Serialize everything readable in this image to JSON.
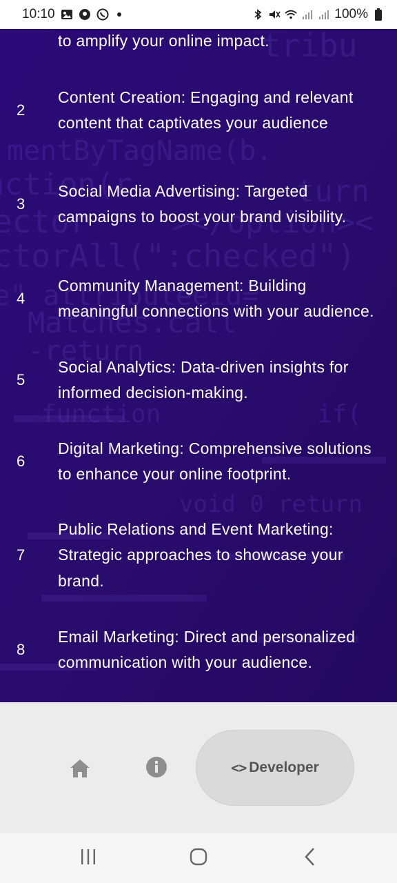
{
  "status_bar": {
    "time": "10:10",
    "battery_percent": "100%",
    "left_icons": [
      "image-icon",
      "location-pin-icon",
      "whatsapp-icon",
      "notification-dot-icon"
    ],
    "right_icons": [
      "bluetooth-icon",
      "mute-icon",
      "wifi-icon",
      "signal-icon",
      "signal-icon",
      "battery-icon"
    ]
  },
  "colors": {
    "content_bg": "#2a0b72",
    "text": "#ffffff",
    "nav_bg": "#ececec",
    "pill_bg": "#dadada",
    "icon_grey": "#8e8e8e"
  },
  "services": [
    {
      "number": "",
      "text": "to amplify your online impact."
    },
    {
      "number": "2",
      "text": "Content Creation: Engaging and relevant content that captivates your audience"
    },
    {
      "number": "3",
      "text": "Social Media Advertising: Targeted campaigns to boost your brand visibility."
    },
    {
      "number": "4",
      "text": "Community Management: Building meaningful connections with your audience."
    },
    {
      "number": "5",
      "text": "Social Analytics: Data-driven insights for informed decision-making."
    },
    {
      "number": "6",
      "text": "Digital Marketing: Comprehensive solutions to enhance your online footprint."
    },
    {
      "number": "7",
      "text": "Public Relations and Event Marketing: Strategic approaches to showcase your brand."
    },
    {
      "number": "8",
      "text": "Email Marketing: Direct and personalized communication with your audience."
    }
  ],
  "bottom_nav": {
    "home_icon": "home-icon",
    "info_icon": "info-icon",
    "developer_icon": "code-icon",
    "developer_glyph": "<>",
    "developer_label": "Developer"
  },
  "system_nav": {
    "recents_icon": "recents-icon",
    "home_icon": "home-circle-icon",
    "back_icon": "back-icon"
  }
}
